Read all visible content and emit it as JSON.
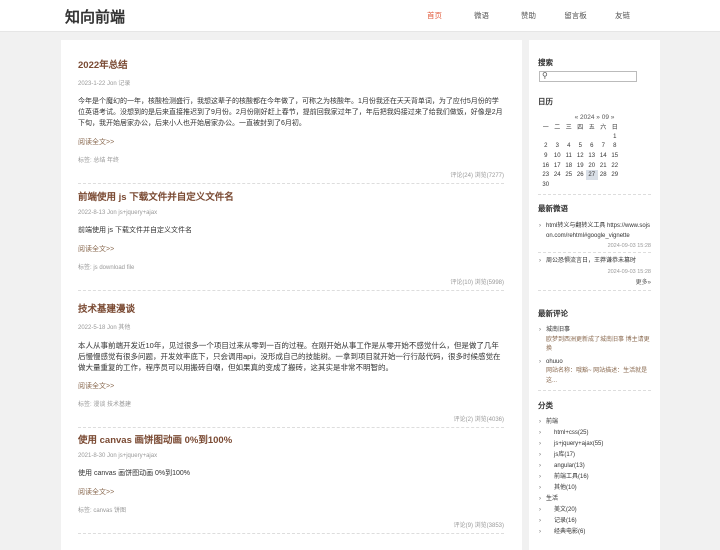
{
  "site": {
    "logo": "知向前端"
  },
  "nav": {
    "items": [
      "首页",
      "微语",
      "赞助",
      "留言板",
      "友链"
    ]
  },
  "posts": [
    {
      "title": "2022年总结",
      "date": "2023-1-22",
      "author": "Jon",
      "category": "记录",
      "summary": "今年是个魔幻的一年，核酸检测盛行，我想这辈子的核酸都在今年做了，可称之为核酸年。1月份我还在天天背单词，为了应付5月份的学位英语考试。没想到的是后来直接推迟到了9月份。2月份刚好赶上春节，提前回我家过年了，年后把我妈接过来了给我们做饭，好像是2月下旬，我开始居家办公，后来小人也开始居家办公。一直被封到了6月初。",
      "read_more": "阅读全文>>",
      "tags": "标签: 总结 年终",
      "stats": "评论(24) 浏览(7277)"
    },
    {
      "title": "前端使用 js 下载文件并自定义文件名",
      "date": "2022-8-13",
      "author": "Jon",
      "category": "js+jquery+ajax",
      "summary": "前端使用 js 下载文件并自定义文件名",
      "read_more": "阅读全文>>",
      "tags": "标签: js download file",
      "stats": "评论(10) 浏览(5998)"
    },
    {
      "title": "技术基建漫谈",
      "date": "2022-5-18",
      "author": "Jon",
      "category": "其他",
      "summary": "本人从事前端开发近10年，见过很多一个项目过来从零到一百的过程。在刚开始从事工作是从零开始不感觉什么，但是做了几年后慢慢感觉有很多问题，开发效率底下，只会调用api，没形成自己的技能树。一拿到项目就开始一行行敲代码，很多时候感觉在做大量重复的工作，程序员可以用搬砖自嘲，但如果真的变成了搬砖，这其实是非常不明智的。",
      "read_more": "阅读全文>>",
      "tags": "标签: 漫谈 技术基建",
      "stats": "评论(2) 浏览(4036)"
    },
    {
      "title": "使用 canvas 画饼图动画 0%到100%",
      "date": "2021-8-30",
      "author": "Jon",
      "category": "js+jquery+ajax",
      "summary": "使用 canvas 画饼图动画 0%到100%",
      "read_more": "阅读全文>>",
      "tags": "标签: canvas 饼图",
      "stats": "评论(9) 浏览(3853)"
    }
  ],
  "sidebar": {
    "search_title": "搜索",
    "search_icon": "search-icon",
    "calendar_title": "日历",
    "calendar_nav": "« 2024 » 09 »",
    "weekdays": [
      "一",
      "二",
      "三",
      "四",
      "五",
      "六",
      "日"
    ],
    "weeks": [
      [
        "",
        "",
        "",
        "",
        "",
        "",
        "1"
      ],
      [
        "2",
        "3",
        "4",
        "5",
        "6",
        "7",
        "8"
      ],
      [
        "9",
        "10",
        "11",
        "12",
        "13",
        "14",
        "15"
      ],
      [
        "16",
        "17",
        "18",
        "19",
        "20",
        "21",
        "22"
      ],
      [
        "23",
        "24",
        "25",
        "26",
        "27",
        "28",
        "29"
      ],
      [
        "30",
        "",
        "",
        "",
        "",
        "",
        ""
      ]
    ],
    "today": "28",
    "weiyu_title": "最新微语",
    "weiyu": [
      {
        "text": "html转义与翻转义工具 https://www.sojson.com/rehtml#google_vignette",
        "date": "2024-09-03 15:28"
      },
      {
        "text": "周公恐惧流言日，王莽谦恭未篡时",
        "date": "2024-09-03 15:28"
      }
    ],
    "weiyu_more": "更多»",
    "comments_title": "最新评论",
    "comments": [
      {
        "user": "城南旧事",
        "text": "欧梦到西洲更新成了城南旧事 博主请更换"
      },
      {
        "user": "ohuuo",
        "text": "网站名称：哦豁~ 网站描述：生活就是这..."
      }
    ],
    "categories_title": "分类",
    "categories": [
      {
        "name": "前端",
        "level": 0
      },
      {
        "name": "html+css(25)",
        "level": 1
      },
      {
        "name": "js+jquery+ajax(55)",
        "level": 1
      },
      {
        "name": "js库(17)",
        "level": 1
      },
      {
        "name": "angular(13)",
        "level": 1
      },
      {
        "name": "前端工具(16)",
        "level": 1
      },
      {
        "name": "其他(10)",
        "level": 1
      },
      {
        "name": "生活",
        "level": 0
      },
      {
        "name": "美文(20)",
        "level": 1
      },
      {
        "name": "记录(16)",
        "level": 1
      },
      {
        "name": "经典电影(6)",
        "level": 1
      }
    ]
  }
}
